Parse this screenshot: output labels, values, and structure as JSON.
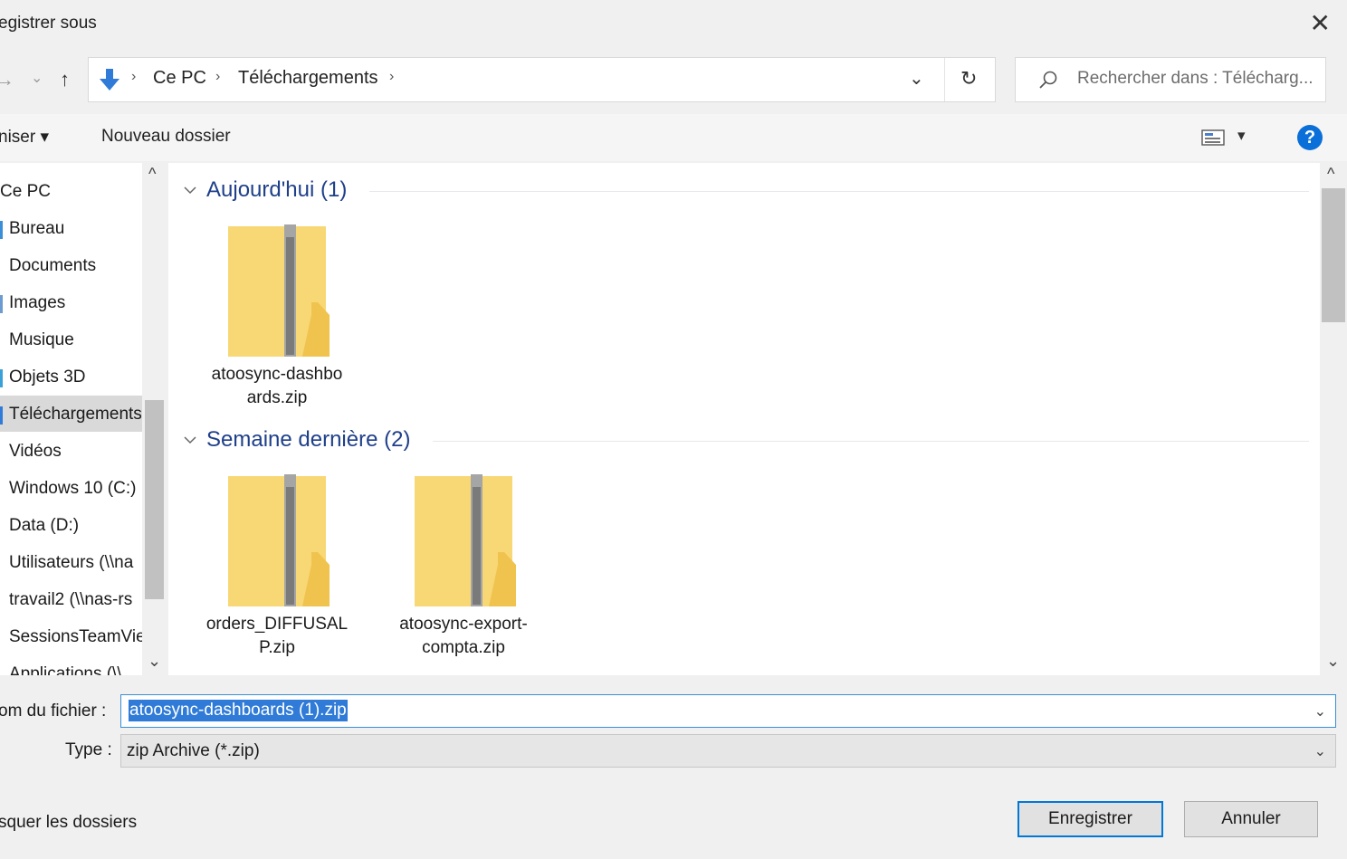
{
  "dialog": {
    "title": "egistrer sous",
    "close_glyph": "✕"
  },
  "nav_buttons": {
    "back_glyph": "→",
    "forward_glyph": "⌄",
    "up_glyph": "↑"
  },
  "address": {
    "segments": [
      "Ce PC",
      "Téléchargements"
    ],
    "separator": "›",
    "dropdown_glyph": "⌄",
    "refresh_glyph": "↻"
  },
  "search": {
    "placeholder": "Rechercher dans : Télécharg..."
  },
  "toolbar": {
    "organize_label": "niser ▾",
    "new_folder_label": "Nouveau dossier",
    "view_dropdown_glyph": "▾",
    "help_glyph": "?"
  },
  "nav": {
    "items": [
      {
        "label": "Ce PC"
      },
      {
        "label": "Bureau"
      },
      {
        "label": "Documents"
      },
      {
        "label": "Images"
      },
      {
        "label": "Musique"
      },
      {
        "label": "Objets 3D"
      },
      {
        "label": "Téléchargements"
      },
      {
        "label": "Vidéos"
      },
      {
        "label": "Windows 10 (C:)"
      },
      {
        "label": "Data (D:)"
      },
      {
        "label": "Utilisateurs (\\\\na"
      },
      {
        "label": "travail2 (\\\\nas-rs"
      },
      {
        "label": "SessionsTeamVie"
      },
      {
        "label": "Applications (\\\\"
      }
    ],
    "selected": "Téléchargements",
    "scroll_up_glyph": "^",
    "scroll_down_glyph": "⌄"
  },
  "groups": [
    {
      "title": "Aujourd'hui (1)",
      "files": [
        {
          "name_line1": "atoosync-dashbo",
          "name_line2": "ards.zip"
        }
      ]
    },
    {
      "title": "Semaine dernière (2)",
      "files": [
        {
          "name_line1": "orders_DIFFUSAL",
          "name_line2": "P.zip"
        },
        {
          "name_line1": "atoosync-export-",
          "name_line2": "compta.zip"
        }
      ]
    }
  ],
  "form": {
    "filename_label": "om du fichier :",
    "filename_value": "atoosync-dashboards (1).zip",
    "type_label": "Type :",
    "type_value": "zip Archive (*.zip)"
  },
  "footer": {
    "hide_folders_label": "squer les dossiers",
    "save_label": "Enregistrer",
    "cancel_label": "Annuler"
  },
  "colors": {
    "accent": "#0078d7",
    "group_title": "#1e3f8a",
    "selection": "#2f7bd7",
    "folder": "#f8d775"
  }
}
